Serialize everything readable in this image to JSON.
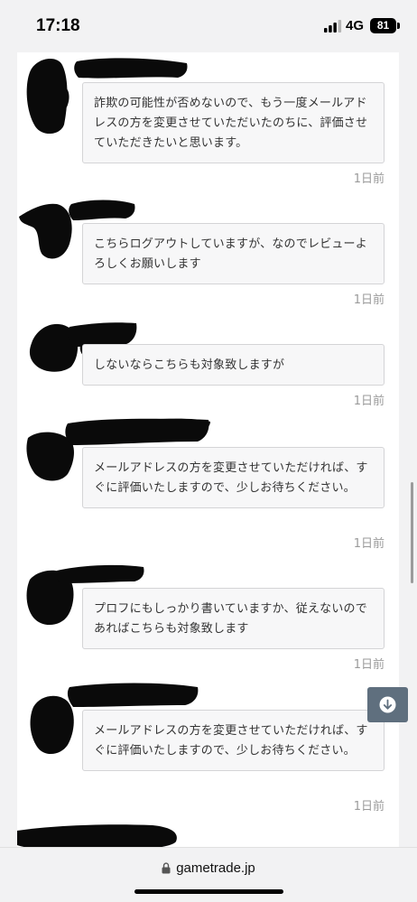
{
  "status_bar": {
    "time": "17:18",
    "network": "4G",
    "battery": "81"
  },
  "messages": [
    {
      "text": "詐欺の可能性が否めないので、もう一度メールアドレスの方を変更させていただいたのちに、評価させていただきたいと思います。",
      "time": "1日前"
    },
    {
      "text": "こちらログアウトしていますが、なのでレビューよろしくお願いします",
      "time": "1日前"
    },
    {
      "text": "しないならこちらも対象致しますが",
      "time": "1日前"
    },
    {
      "text": "メールアドレスの方を変更させていただければ、すぐに評価いたしますので、少しお待ちください。",
      "time": "1日前"
    },
    {
      "text": "プロフにもしっかり書いていますか、従えないのであればこちらも対象致します",
      "time": "1日前"
    },
    {
      "text": "メールアドレスの方を変更させていただければ、すぐに評価いたしますので、少しお待ちください。",
      "time": "1日前"
    }
  ],
  "address_bar": {
    "url": "gametrade.jp"
  },
  "icons": {
    "scroll_down": "arrow-down-circle-icon",
    "lock": "lock-icon",
    "signal": "signal-icon"
  }
}
